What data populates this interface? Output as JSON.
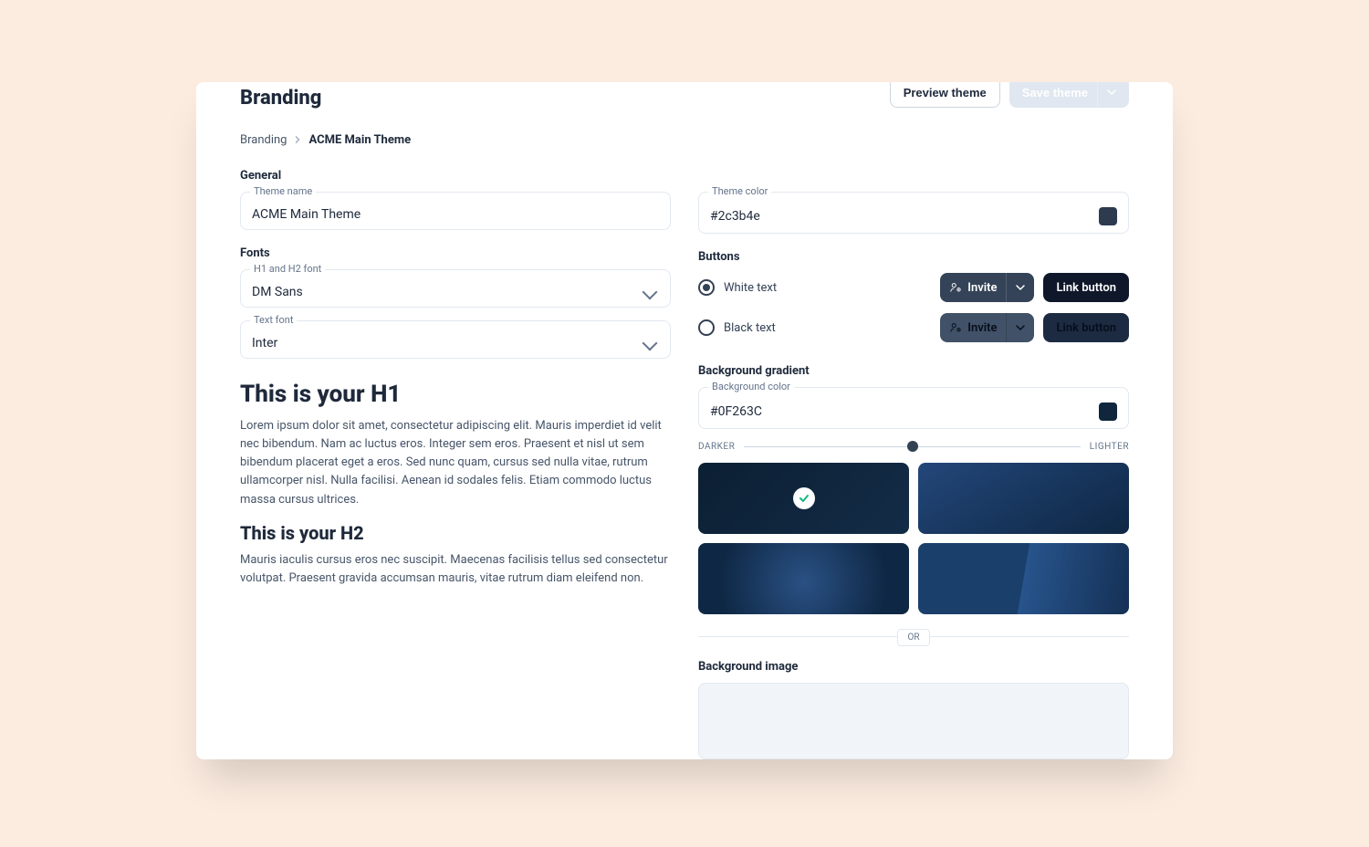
{
  "header": {
    "title": "Branding",
    "preview_label": "Preview theme",
    "save_label": "Save theme"
  },
  "breadcrumb": {
    "root": "Branding",
    "current": "ACME Main Theme"
  },
  "general": {
    "section": "General",
    "theme_name_label": "Theme name",
    "theme_name_value": "ACME Main Theme",
    "theme_color_label": "Theme color",
    "theme_color_value": "#2c3b4e"
  },
  "fonts": {
    "section": "Fonts",
    "h_font_label": "H1 and H2 font",
    "h_font_value": "DM Sans",
    "text_font_label": "Text font",
    "text_font_value": "Inter"
  },
  "preview": {
    "h1": "This is your H1",
    "p1": "Lorem ipsum dolor sit amet, consectetur adipiscing elit. Mauris imperdiet id velit nec bibendum. Nam ac luctus eros. Integer sem eros. Praesent et nisl ut sem bibendum placerat eget a eros. Sed nunc quam, cursus sed nulla vitae, rutrum ullamcorper nisl. Nulla facilisi. Aenean id sodales felis. Etiam commodo luctus massa cursus ultrices.",
    "h2": "This is your H2",
    "p2": "Mauris iaculis cursus eros nec suscipit. Maecenas facilisis tellus sed consectetur volutpat. Praesent gravida accumsan mauris, vitae rutrum diam eleifend non."
  },
  "buttons": {
    "section": "Buttons",
    "white_label": "White text",
    "black_label": "Black text",
    "invite_label": "Invite",
    "link_label": "Link button"
  },
  "gradient": {
    "section": "Background gradient",
    "color_label": "Background color",
    "color_value": "#0F263C",
    "darker": "DARKER",
    "lighter": "LIGHTER",
    "or": "OR"
  },
  "bg_image": {
    "section": "Background image"
  }
}
